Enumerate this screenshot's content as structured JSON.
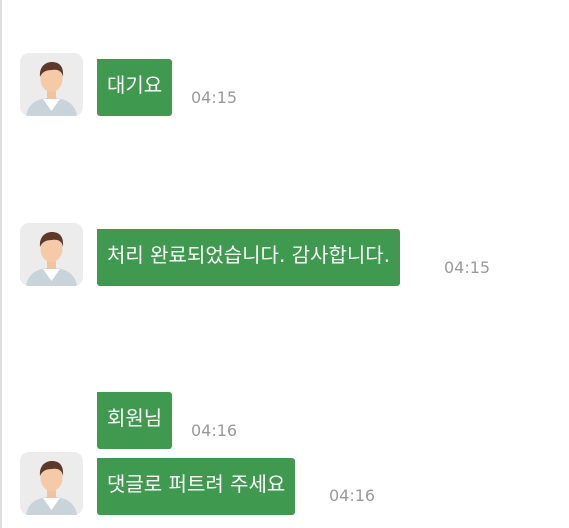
{
  "messages": [
    {
      "text": "대기요",
      "time": "04:15"
    },
    {
      "text": "처리 완료되었습니다. 감사합니다.",
      "time": "04:15"
    },
    {
      "text": "회원님",
      "time": "04:16"
    },
    {
      "text": "댓글로 퍼트려 주세요",
      "time": "04:16"
    }
  ],
  "colors": {
    "bubble": "#3f9a4f",
    "timestamp": "#9a9a9a",
    "avatar_bg": "#ececec"
  },
  "icons": {
    "avatar": "user-avatar-icon"
  }
}
